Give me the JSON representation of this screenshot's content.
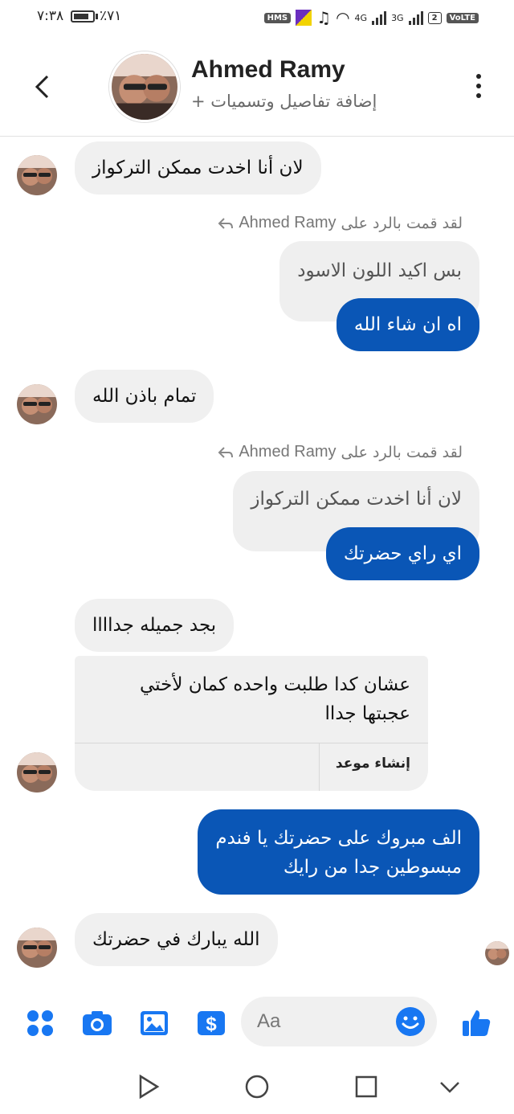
{
  "status_bar": {
    "time": "٧:٣٨",
    "battery": "٪٧١",
    "chips": [
      "HMS",
      "VoLTE"
    ],
    "net1": "4G",
    "net2": "3G",
    "sim": "2"
  },
  "header": {
    "contact_name": "Ahmed Ramy",
    "subtitle": "إضافة تفاصيل وتسميات +"
  },
  "messages": [
    {
      "id": "m1",
      "side": "in",
      "text": "لان أنا اخدت ممكن التركواز"
    },
    {
      "id": "m2",
      "side": "reply_note",
      "name": "Ahmed Ramy",
      "text": "لقد قمت بالرد على"
    },
    {
      "id": "m3",
      "side": "quote",
      "text": "بس اكيد اللون الاسود"
    },
    {
      "id": "m4",
      "side": "out",
      "text": "اه ان شاء الله"
    },
    {
      "id": "m5",
      "side": "in",
      "text": "تمام باذن الله"
    },
    {
      "id": "m6",
      "side": "reply_note",
      "name": "Ahmed Ramy",
      "text": "لقد قمت بالرد على"
    },
    {
      "id": "m7",
      "side": "quote",
      "text": "لان أنا اخدت ممكن التركواز"
    },
    {
      "id": "m8",
      "side": "out",
      "text": "اي راي حضرتك"
    },
    {
      "id": "m9",
      "side": "in",
      "text": "بجد جميله جداااا"
    },
    {
      "id": "m10",
      "side": "in_card",
      "text": "عشان كدا طلبت واحده كمان لأختي عجبتها جداا",
      "action": "إنشاء موعد"
    },
    {
      "id": "m11",
      "side": "out",
      "lines": [
        "الف مبروك على حضرتك يا فندم",
        "مبسوطين جدا من رايك"
      ]
    },
    {
      "id": "m12",
      "side": "in",
      "text": "الله يبارك في حضرتك"
    }
  ],
  "composer": {
    "placeholder": "Aa",
    "icons": [
      "apps-icon",
      "camera-icon",
      "gallery-icon",
      "payment-icon",
      "emoji-icon",
      "thumbs-up-icon"
    ]
  },
  "colors": {
    "outgoing": "#0a56b6",
    "incoming": "#f0f0f0",
    "accent": "#1877f2"
  }
}
